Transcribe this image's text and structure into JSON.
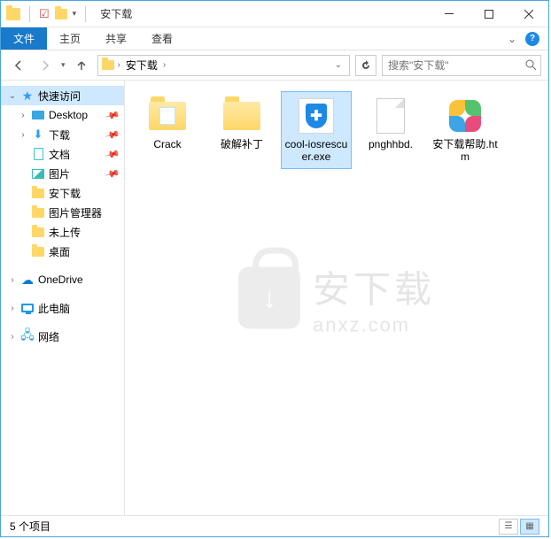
{
  "window": {
    "title": "安下载"
  },
  "ribbon": {
    "file": "文件",
    "home": "主页",
    "share": "共享",
    "view": "查看"
  },
  "breadcrumb": {
    "segment": "安下载"
  },
  "search": {
    "placeholder": "搜索\"安下载\""
  },
  "sidebar": {
    "quick_access": "快速访问",
    "items": [
      {
        "label": "Desktop",
        "icon": "desktop"
      },
      {
        "label": "下载",
        "icon": "download"
      },
      {
        "label": "文档",
        "icon": "doc"
      },
      {
        "label": "图片",
        "icon": "pic"
      },
      {
        "label": "安下载",
        "icon": "folder"
      },
      {
        "label": "图片管理器",
        "icon": "folder"
      },
      {
        "label": "未上传",
        "icon": "folder"
      },
      {
        "label": "桌面",
        "icon": "folder"
      }
    ],
    "onedrive": "OneDrive",
    "thispc": "此电脑",
    "network": "网络"
  },
  "files": [
    {
      "name": "Crack",
      "type": "folder-doc"
    },
    {
      "name": "破解补丁",
      "type": "folder"
    },
    {
      "name": "cool-iosrescuer.exe",
      "type": "exe",
      "selected": true
    },
    {
      "name": "pnghhbd.",
      "type": "blank"
    },
    {
      "name": "安下载帮助.htm",
      "type": "htm"
    }
  ],
  "statusbar": {
    "count": "5 个项目"
  },
  "watermark": {
    "cn": "安下载",
    "en": "anxz.com"
  }
}
